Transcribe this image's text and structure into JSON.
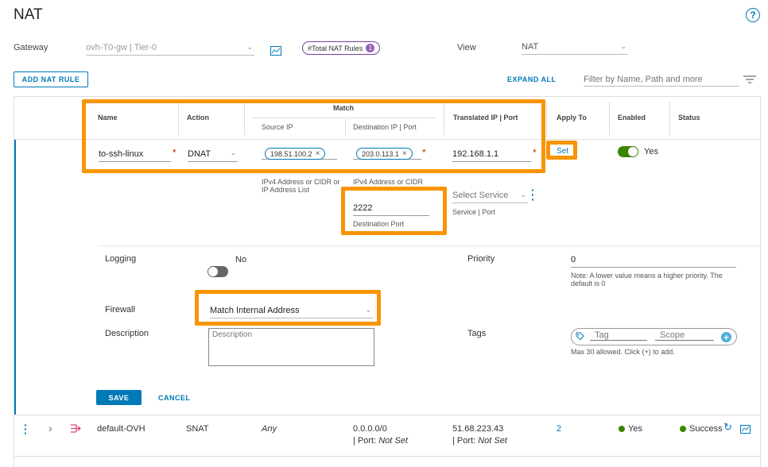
{
  "page": {
    "title": "NAT",
    "help_icon": "?"
  },
  "filters": {
    "gateway_label": "Gateway",
    "gateway_value": "ovh-T0-gw | Tier-0",
    "total_rules_label": "#Total NAT Rules",
    "total_rules_count": "1",
    "view_label": "View",
    "view_value": "NAT"
  },
  "toolbar": {
    "add_rule": "ADD NAT RULE",
    "expand_all": "EXPAND ALL",
    "filter_placeholder": "Filter by Name, Path and more"
  },
  "table": {
    "headers": {
      "name": "Name",
      "action": "Action",
      "match": "Match",
      "source_ip": "Source IP",
      "destination": "Destination IP | Port",
      "translated": "Translated IP | Port",
      "apply_to": "Apply To",
      "enabled": "Enabled",
      "status": "Status"
    }
  },
  "edit_row": {
    "name": "to-ssh-linux",
    "action": "DNAT",
    "source_chip": "198.51.100.2",
    "source_hint": "IPv4 Address or CIDR or IP Address List",
    "dest_chip": "203.0.113.1",
    "dest_hint": "IPv4 Address or CIDR",
    "translated_ip": "192.168.1.1",
    "apply_to": "Set",
    "enabled_text": "Yes",
    "dest_port": "2222",
    "dest_port_label": "Destination Port",
    "service_placeholder": "Select Service",
    "service_label": "Service | Port",
    "logging_label": "Logging",
    "logging_value": "No",
    "priority_label": "Priority",
    "priority_value": "0",
    "priority_hint": "Note: A lower value means a higher priority. The default is 0",
    "firewall_label": "Firewall",
    "firewall_value": "Match Internal Address",
    "description_label": "Description",
    "description_placeholder": "Description",
    "tags_label": "Tags",
    "tag_placeholder": "Tag",
    "scope_placeholder": "Scope",
    "tags_hint": "Max 30 allowed. Click (+) to add.",
    "save": "SAVE",
    "cancel": "CANCEL"
  },
  "rows": [
    {
      "name": "default-OVH",
      "action": "SNAT",
      "source": "Any",
      "dest_ip": "0.0.0.0/0",
      "dest_port_prefix": "| Port:",
      "dest_port_value": "Not Set",
      "trans_ip": "51.68.223.43",
      "trans_port_prefix": "| Port:",
      "trans_port_value": "Not Set",
      "apply_to": "2",
      "enabled": "Yes",
      "status": "Success"
    }
  ],
  "colors": {
    "accent": "#0079b8",
    "highlight": "#f89406",
    "success": "#3c8500",
    "toggle_on": "#3c8500"
  }
}
